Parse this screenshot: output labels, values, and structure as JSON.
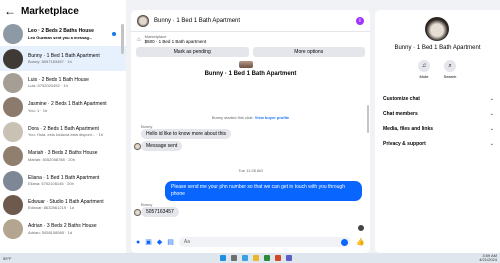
{
  "sidebar": {
    "title": "Marketplace",
    "conversations": [
      {
        "name": "Leo · 2 Beds 2 Baths House",
        "sub": "Leo Guzman sent you a messag...",
        "color": "#8d9aa6",
        "bold": true,
        "unread": true
      },
      {
        "name": "Bunny · 1 Bed 1 Bath Apartment",
        "sub": "Bunny: 5057163457 · 1h",
        "color": "#3f3a36",
        "active": true
      },
      {
        "name": "Luis · 2 Beds 1 Bath House",
        "sub": "Luis: 5752020452 · 1h",
        "color": "#a59e94"
      },
      {
        "name": "Jasmine · 2 Beds 1 Bath Apartment",
        "sub": "You: 1 · 1h",
        "color": "#8c7a6c"
      },
      {
        "name": "Dora · 2 Beds 1 Bath Apartment",
        "sub": "You: Hola, esto todavía está disponi... · 1h",
        "color": "#c9c1b3"
      },
      {
        "name": "Mariah · 3 Beds 2 Baths House",
        "sub": "Mariah: 5052058788 · 20h",
        "color": "#907f6e"
      },
      {
        "name": "Eliana · 1 Bed 1 Bath Apartment",
        "sub": "Eliana: 5752105146 · 20h",
        "color": "#7d8796"
      },
      {
        "name": "Edwuar · Studio 1 Bath Apartment",
        "sub": "Edwuar: 8632861219 · 1d",
        "color": "#6d5a4c"
      },
      {
        "name": "Adrian · 3 Beds 2 Baths House",
        "sub": "Adrian: 5058108565 · 1d",
        "color": "#b3a58f"
      }
    ]
  },
  "chat": {
    "title": "Bunny · 1 Bed 1 Bath Apartment",
    "listing_label": "Marketplace",
    "listing_price": "$500 · 1 Bed 1 Bath apartment",
    "mark_pending": "Mark as pending",
    "more_options": "More options",
    "product_title": "Bunny · 1 Bed 1 Bath Apartment",
    "system_msg": "Bunny started this chat.",
    "system_link": "View buyer profile",
    "sender_1": "Bunny",
    "msg_1": "Hello id like to know more about this",
    "msg_2": "Message sent",
    "time": "Tue 11:28 AM",
    "msg_out": "Please send me your phn number so that we can get in touch with you through phone",
    "sender_2": "Bunny",
    "msg_3": "5057163457",
    "composer_placeholder": "Aa"
  },
  "details": {
    "name": "Bunny · 1 Bed 1 Bath Apartment",
    "mute": "Mute",
    "search": "Search",
    "items": [
      "Customize chat",
      "Chat members",
      "Media, files and links",
      "Privacy & support"
    ]
  },
  "taskbar": {
    "temp": "59°F",
    "time": "3:59 AM",
    "date": "4/21/2024"
  }
}
